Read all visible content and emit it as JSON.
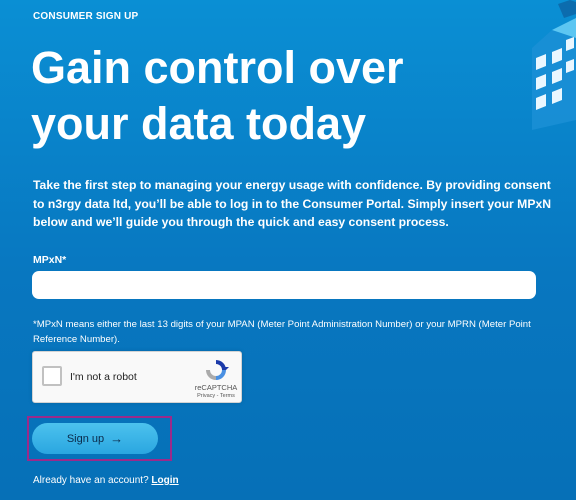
{
  "eyebrow": "CONSUMER SIGN UP",
  "headline": "Gain control over your data today",
  "intro": "Take the first step to managing your energy usage with confidence. By providing consent to n3rgy data ltd, you’ll be able to log in to the Consumer Portal. Simply insert your MPxN below and we’ll guide you through the quick and easy consent process.",
  "form": {
    "mpxn_label": "MPxN*",
    "mpxn_value": "",
    "mpxn_placeholder": "",
    "help_text": "*MPxN means either the last 13 digits of your MPAN (Meter Point Administration Number) or your MPRN (Meter Point Reference Number)."
  },
  "recaptcha": {
    "label": "I'm not a robot",
    "brand": "reCAPTCHA",
    "terms": "Privacy - Terms",
    "checked": false
  },
  "signup_button": {
    "label": "Sign up",
    "arrow": "→"
  },
  "login": {
    "prompt": "Already have an account?",
    "link": "Login"
  },
  "colors": {
    "background": "#0877c0",
    "button": "#2aa6e0",
    "focus_outline": "#9c2a8a",
    "text": "#ffffff"
  }
}
